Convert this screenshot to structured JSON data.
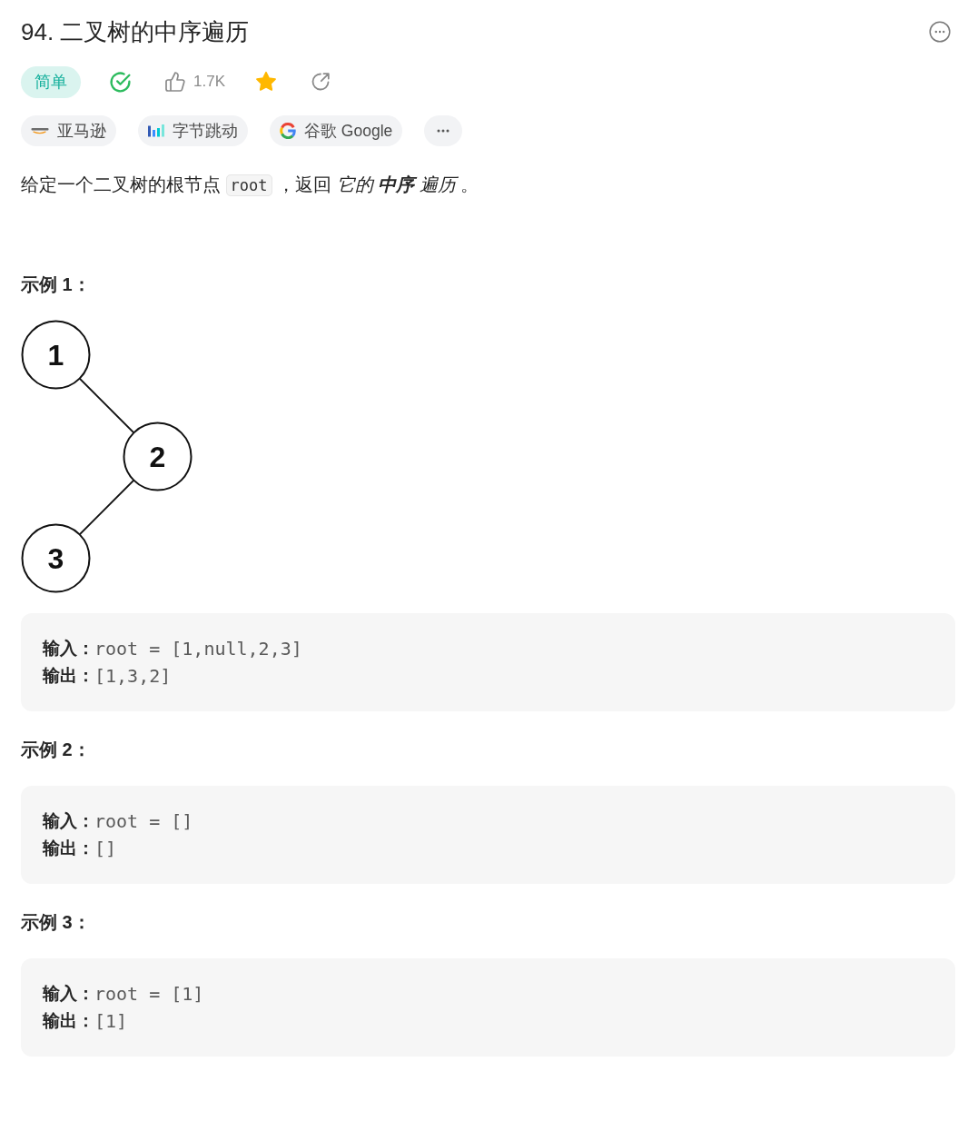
{
  "header": {
    "title": "94. 二叉树的中序遍历"
  },
  "meta": {
    "difficulty": {
      "label": "简单",
      "kind": "easy"
    },
    "solved": true,
    "likes": "1.7K",
    "favorited": true
  },
  "companies": [
    {
      "name": "亚马逊",
      "kind": "smile"
    },
    {
      "name": "字节跳动",
      "kind": "bars"
    },
    {
      "name": "谷歌 Google",
      "kind": "g"
    }
  ],
  "description": [
    {
      "kind": "text",
      "text": "给定一个二叉树的根节点 "
    },
    {
      "kind": "code",
      "text": "root"
    },
    {
      "kind": "text",
      "text": " ，返回 "
    },
    {
      "kind": "em",
      "text": "它的 "
    },
    {
      "kind": "strong_em",
      "text": "中序"
    },
    {
      "kind": "em",
      "text": " 遍历"
    },
    {
      "kind": "text",
      "text": " 。"
    }
  ],
  "examples": [
    {
      "heading": "示例 1：",
      "tree": {
        "label": "1",
        "children": [
          {
            "label": "2",
            "kind": "right",
            "children": [
              {
                "label": "3",
                "kind": "left"
              }
            ]
          }
        ]
      },
      "lines": [
        {
          "label": "输入：",
          "value": "root = [1,null,2,3]"
        },
        {
          "label": "输出：",
          "value": "[1,3,2]"
        }
      ]
    },
    {
      "heading": "示例 2：",
      "lines": [
        {
          "label": "输入：",
          "value": "root = []"
        },
        {
          "label": "输出：",
          "value": "[]"
        }
      ]
    },
    {
      "heading": "示例 3：",
      "lines": [
        {
          "label": "输入：",
          "value": "root = [1]"
        },
        {
          "label": "输出：",
          "value": "[1]"
        }
      ]
    }
  ]
}
